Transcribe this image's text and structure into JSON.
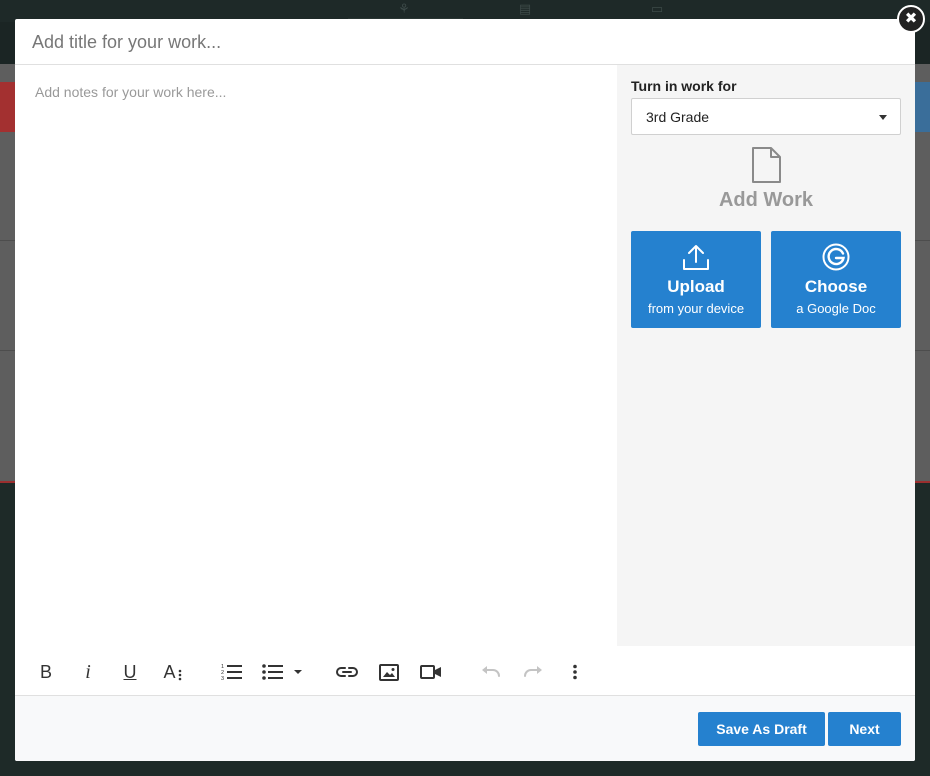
{
  "modal": {
    "title_placeholder": "Add title for your work...",
    "title_value": "",
    "notes_placeholder": "Add notes for your work here...",
    "close_icon": "close-icon"
  },
  "side_panel": {
    "turn_in_label": "Turn in work for",
    "class_select": {
      "selected": "3rd Grade"
    },
    "add_work_label": "Add Work",
    "add_work_icon": "file-icon",
    "upload": {
      "title": "Upload",
      "subtitle": "from your device",
      "icon": "upload-icon"
    },
    "google": {
      "title": "Choose",
      "subtitle": "a Google Doc",
      "icon": "google-icon"
    }
  },
  "toolbar": {
    "items": [
      "bold",
      "italic",
      "underline",
      "font-size",
      "ordered-list",
      "bullet-list",
      "link",
      "image",
      "video",
      "undo",
      "redo",
      "more"
    ],
    "bold_glyph": "B",
    "italic_glyph": "i",
    "underline_glyph": "U",
    "fontsize_glyph": "A"
  },
  "footer": {
    "save_draft_label": "Save As Draft",
    "next_label": "Next"
  },
  "colors": {
    "accent": "#2581cf",
    "panel_bg": "#f5f5f5"
  }
}
